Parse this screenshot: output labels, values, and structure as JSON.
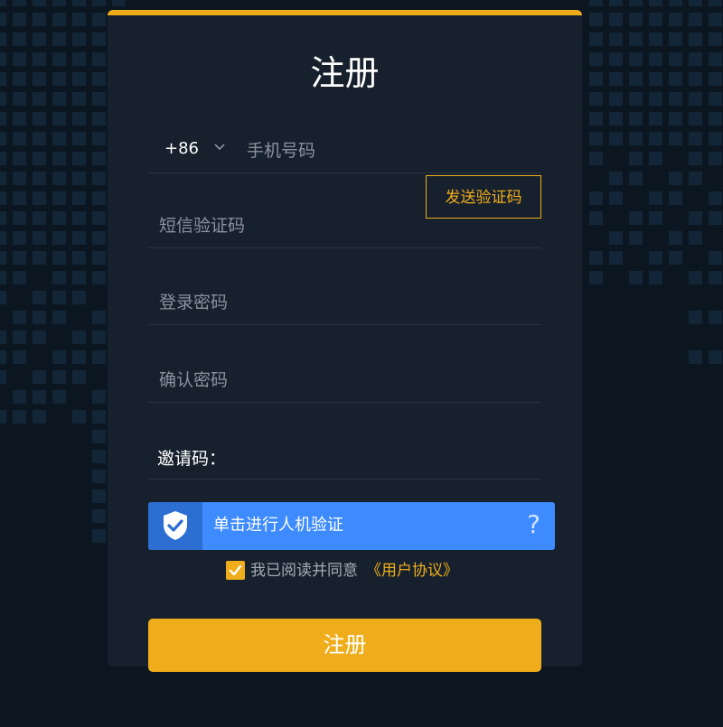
{
  "page": {
    "title": "注册"
  },
  "form": {
    "country_code": "+86",
    "phone_placeholder": "手机号码",
    "sms_placeholder": "短信验证码",
    "send_code_label": "发送验证码",
    "password_placeholder": "登录密码",
    "confirm_password_placeholder": "确认密码",
    "invite_label": "邀请码：",
    "invite_value": ""
  },
  "captcha": {
    "label": "单击进行人机验证",
    "help": "?"
  },
  "agreement": {
    "text": "我已阅读并同意",
    "link": "《用户协议》",
    "checked": true
  },
  "submit_label": "注册",
  "colors": {
    "accent": "#f0ad1b",
    "captcha_blue": "#3d8bff",
    "card_bg": "#17212e",
    "page_bg": "#0c1621"
  },
  "icons": {
    "captcha": "shield-check-icon",
    "checkbox": "checkmark-icon",
    "dropdown": "chevron-down-icon"
  }
}
